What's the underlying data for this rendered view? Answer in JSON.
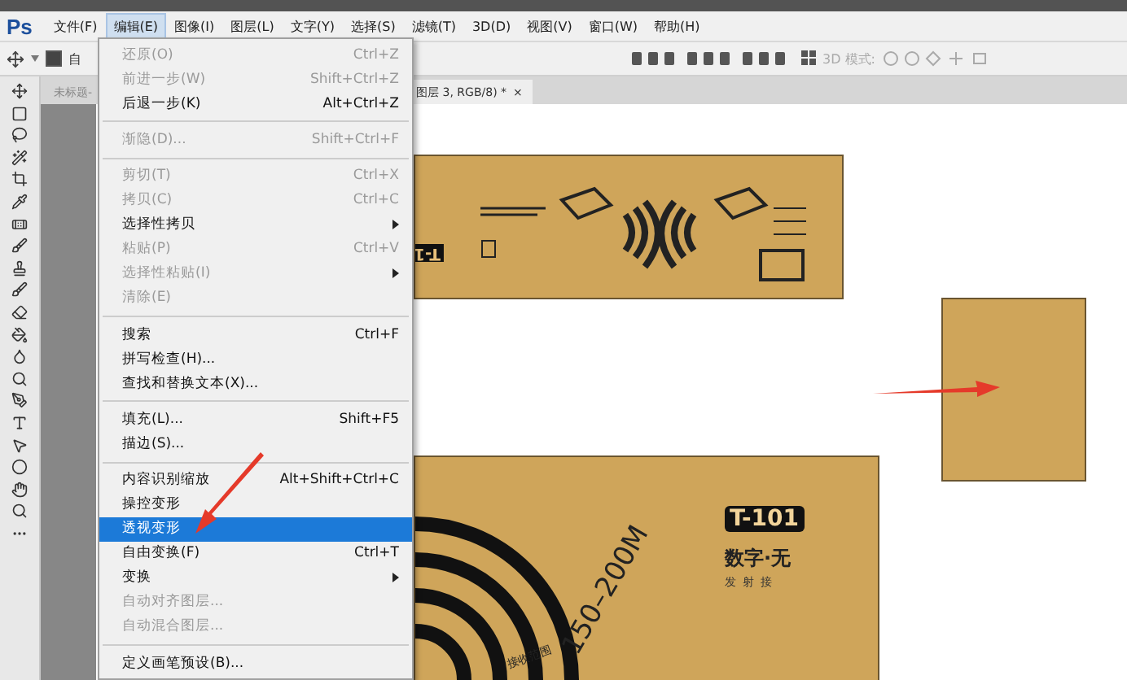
{
  "app": {
    "logo": "Ps"
  },
  "menubar": [
    {
      "label": "文件(F)",
      "selected": false
    },
    {
      "label": "编辑(E)",
      "selected": true
    },
    {
      "label": "图像(I)",
      "selected": false
    },
    {
      "label": "图层(L)",
      "selected": false
    },
    {
      "label": "文字(Y)",
      "selected": false
    },
    {
      "label": "选择(S)",
      "selected": false
    },
    {
      "label": "滤镜(T)",
      "selected": false
    },
    {
      "label": "3D(D)",
      "selected": false
    },
    {
      "label": "视图(V)",
      "selected": false
    },
    {
      "label": "窗口(W)",
      "selected": false
    },
    {
      "label": "帮助(H)",
      "selected": false
    }
  ],
  "options_bar": {
    "auto_select": {
      "label": "自",
      "checked": true
    },
    "mode_label": "3D 模式:"
  },
  "tabs": [
    {
      "label": "未标题-",
      "selected": false
    },
    {
      "label": "图层 3, RGB/8) *",
      "selected": true,
      "close": "×"
    }
  ],
  "edit_menu": [
    {
      "kind": "item",
      "label": "还原(O)",
      "shortcut": "Ctrl+Z",
      "disabled": true,
      "selected": false
    },
    {
      "kind": "item",
      "label": "前进一步(W)",
      "shortcut": "Shift+Ctrl+Z",
      "disabled": true,
      "selected": false
    },
    {
      "kind": "item",
      "label": "后退一步(K)",
      "shortcut": "Alt+Ctrl+Z",
      "disabled": false,
      "selected": false
    },
    {
      "kind": "separator"
    },
    {
      "kind": "item",
      "label": "渐隐(D)...",
      "shortcut": "Shift+Ctrl+F",
      "disabled": true,
      "selected": false
    },
    {
      "kind": "separator"
    },
    {
      "kind": "item",
      "label": "剪切(T)",
      "shortcut": "Ctrl+X",
      "disabled": true,
      "selected": false
    },
    {
      "kind": "item",
      "label": "拷贝(C)",
      "shortcut": "Ctrl+C",
      "disabled": true,
      "selected": false
    },
    {
      "kind": "submenu",
      "label": "选择性拷贝",
      "disabled": false,
      "selected": false
    },
    {
      "kind": "item",
      "label": "粘贴(P)",
      "shortcut": "Ctrl+V",
      "disabled": true,
      "selected": false
    },
    {
      "kind": "submenu",
      "label": "选择性粘贴(I)",
      "disabled": true,
      "selected": false
    },
    {
      "kind": "item",
      "label": "清除(E)",
      "disabled": true,
      "selected": false
    },
    {
      "kind": "separator"
    },
    {
      "kind": "item",
      "label": "搜索",
      "shortcut": "Ctrl+F",
      "disabled": false,
      "selected": false
    },
    {
      "kind": "item",
      "label": "拼写检查(H)...",
      "disabled": false,
      "selected": false
    },
    {
      "kind": "item",
      "label": "查找和替换文本(X)...",
      "disabled": false,
      "selected": false
    },
    {
      "kind": "separator"
    },
    {
      "kind": "item",
      "label": "填充(L)...",
      "shortcut": "Shift+F5",
      "disabled": false,
      "selected": false
    },
    {
      "kind": "item",
      "label": "描边(S)...",
      "disabled": false,
      "selected": false
    },
    {
      "kind": "separator"
    },
    {
      "kind": "item",
      "label": "内容识别缩放",
      "shortcut": "Alt+Shift+Ctrl+C",
      "disabled": false,
      "selected": false
    },
    {
      "kind": "item",
      "label": "操控变形",
      "disabled": false,
      "selected": false
    },
    {
      "kind": "item",
      "label": "透视变形",
      "disabled": false,
      "selected": true
    },
    {
      "kind": "item",
      "label": "自由变换(F)",
      "shortcut": "Ctrl+T",
      "disabled": false,
      "selected": false
    },
    {
      "kind": "submenu",
      "label": "变换",
      "disabled": false,
      "selected": false
    },
    {
      "kind": "item",
      "label": "自动对齐图层...",
      "disabled": true,
      "selected": false
    },
    {
      "kind": "item",
      "label": "自动混合图层...",
      "disabled": true,
      "selected": false
    },
    {
      "kind": "separator"
    },
    {
      "kind": "item",
      "label": "定义画笔预设(B)...",
      "disabled": false,
      "selected": false
    }
  ],
  "artwork": {
    "top_code": "T-1",
    "model": "T-101",
    "title": "数字·无",
    "subtitle": "发射接",
    "range": "150–200M",
    "range_label": "接收范围"
  }
}
